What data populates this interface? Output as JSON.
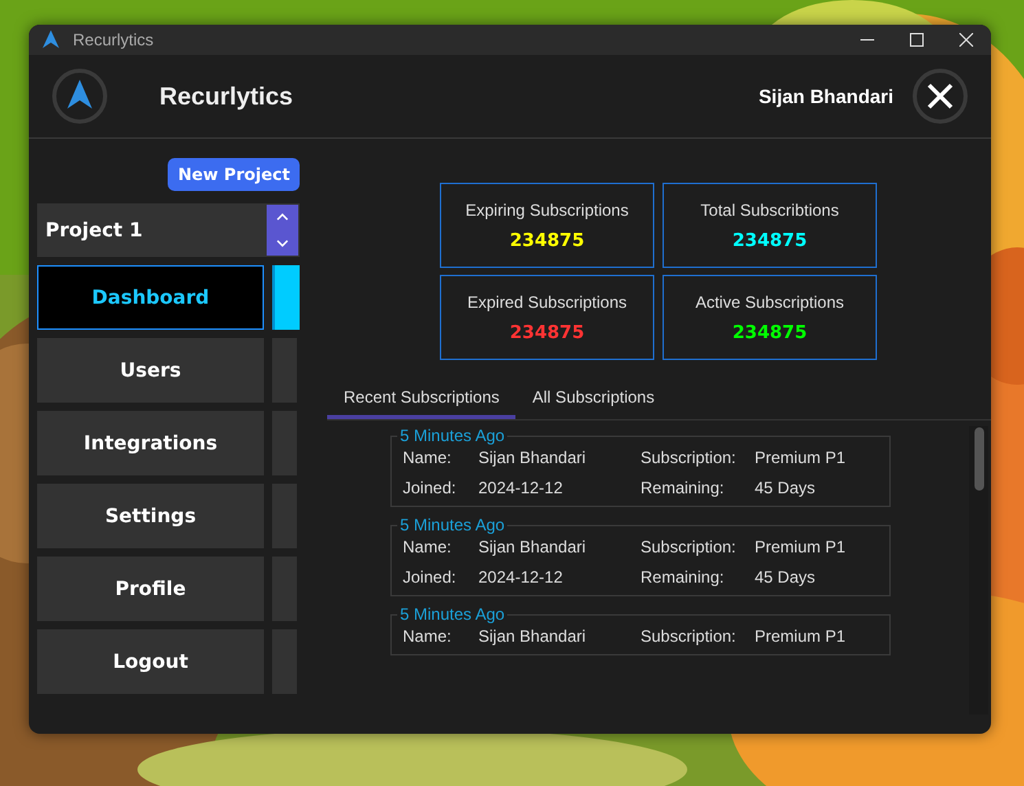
{
  "window": {
    "title": "Recurlytics"
  },
  "header": {
    "app_name": "Recurlytics",
    "user": "Sijan Bhandari"
  },
  "sidebar": {
    "new_project_button": "New Project",
    "project": "Project 1",
    "nav": [
      {
        "label": "Dashboard",
        "selected": true
      },
      {
        "label": "Users",
        "selected": false
      },
      {
        "label": "Integrations",
        "selected": false
      },
      {
        "label": "Settings",
        "selected": false
      },
      {
        "label": "Profile",
        "selected": false
      },
      {
        "label": "Logout",
        "selected": false
      }
    ]
  },
  "stats": [
    {
      "title": "Expiring Subscriptions",
      "value": "234875",
      "color": "#ffff00"
    },
    {
      "title": "Total Subscribtions",
      "value": "234875",
      "color": "#00ffff"
    },
    {
      "title": "Expired Subscriptions",
      "value": "234875",
      "color": "#ff3333"
    },
    {
      "title": "Active Subscriptions",
      "value": "234875",
      "color": "#00ff00"
    }
  ],
  "tabs": [
    {
      "label": "Recent Subscriptions",
      "selected": true
    },
    {
      "label": "All Subscriptions",
      "selected": false
    }
  ],
  "entries": [
    {
      "time": "5 Minutes Ago",
      "fields": [
        {
          "label": "Name:",
          "value": "Sijan Bhandari"
        },
        {
          "label": "Subscription:",
          "value": "Premium P1"
        },
        {
          "label": "Joined:",
          "value": "2024-12-12"
        },
        {
          "label": "Remaining:",
          "value": "45 Days"
        }
      ]
    },
    {
      "time": "5 Minutes Ago",
      "fields": [
        {
          "label": "Name:",
          "value": "Sijan Bhandari"
        },
        {
          "label": "Subscription:",
          "value": "Premium P1"
        },
        {
          "label": "Joined:",
          "value": "2024-12-12"
        },
        {
          "label": "Remaining:",
          "value": "45 Days"
        }
      ]
    },
    {
      "time": "5 Minutes Ago",
      "fields": [
        {
          "label": "Name:",
          "value": "Sijan Bhandari"
        },
        {
          "label": "Subscription:",
          "value": "Premium P1"
        }
      ]
    }
  ]
}
